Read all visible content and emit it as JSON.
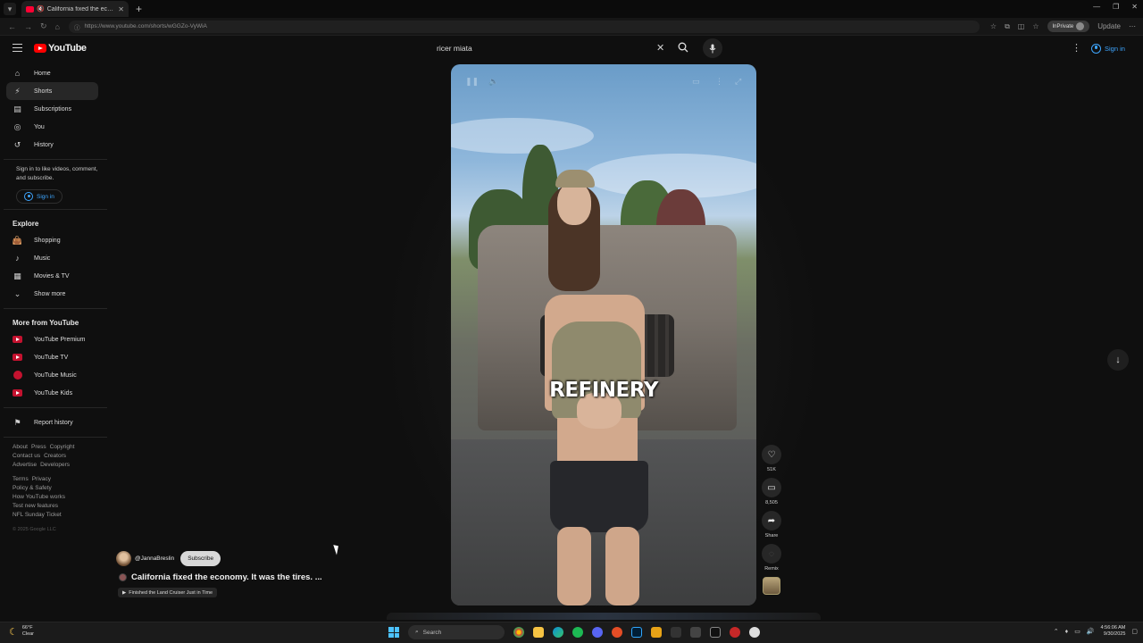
{
  "browser": {
    "tab_title": "California fixed the econo",
    "url": "https://www.youtube.com/shorts/wGGZo-VyWiA",
    "profile_label": "InPrivate",
    "update_label": "Update"
  },
  "header": {
    "logo_text": "YouTube",
    "search_value": "ricer miata",
    "signin_label": "Sign in"
  },
  "sidebar": {
    "main_items": [
      {
        "label": "Home",
        "icon": "home-icon"
      },
      {
        "label": "Shorts",
        "icon": "shorts-icon"
      },
      {
        "label": "Subscriptions",
        "icon": "subscriptions-icon"
      },
      {
        "label": "You",
        "icon": "you-icon"
      },
      {
        "label": "History",
        "icon": "history-icon"
      }
    ],
    "signin_note": "Sign in to like videos, comment, and subscribe.",
    "signin_button": "Sign in",
    "explore_title": "Explore",
    "explore_items": [
      {
        "label": "Shopping",
        "icon": "shopping-icon"
      },
      {
        "label": "Music",
        "icon": "music-icon"
      },
      {
        "label": "Movies & TV",
        "icon": "movies-icon"
      },
      {
        "label": "Show more",
        "icon": "chevron-down-icon"
      }
    ],
    "more_title": "More from YouTube",
    "more_items": [
      {
        "label": "YouTube Premium",
        "icon": "youtube-premium-icon"
      },
      {
        "label": "YouTube TV",
        "icon": "youtube-tv-icon"
      },
      {
        "label": "YouTube Music",
        "icon": "youtube-music-icon"
      },
      {
        "label": "YouTube Kids",
        "icon": "youtube-kids-icon"
      }
    ],
    "report_history": "Report history",
    "footer_row1": [
      "About",
      "Press",
      "Copyright"
    ],
    "footer_row2": [
      "Contact us",
      "Creators"
    ],
    "footer_row3": [
      "Advertise",
      "Developers"
    ],
    "footer_row4": [
      "Terms",
      "Privacy"
    ],
    "footer_row5": [
      "Policy & Safety"
    ],
    "footer_row6": [
      "How YouTube works"
    ],
    "footer_row7": [
      "Test new features"
    ],
    "footer_row8": [
      "NFL Sunday Ticket"
    ],
    "copyright": "© 2025 Google LLC"
  },
  "short": {
    "caption": "REFINERY",
    "channel": "@JannaBreslin",
    "subscribe_label": "Subscribe",
    "title": "California fixed the economy. It was the tires. ...",
    "chip": "Finished the Land Cruiser Just in Time",
    "likes": "51K",
    "comments": "8,505",
    "share_label": "Share",
    "remix_label": "Remix"
  },
  "taskbar": {
    "temp": "66°F",
    "weather": "Clear",
    "search_placeholder": "Search",
    "time": "4:56:06 AM",
    "date": "9/30/2025"
  }
}
